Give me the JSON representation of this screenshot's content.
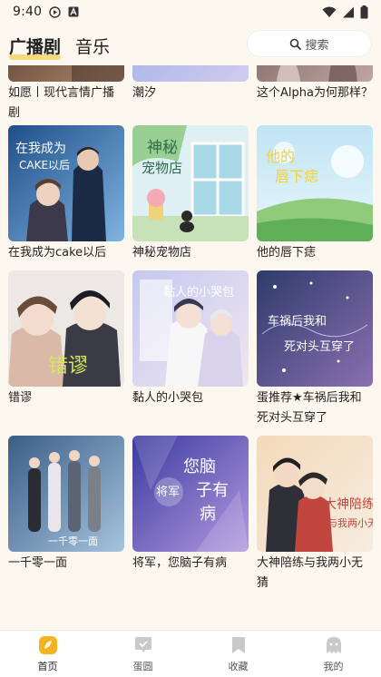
{
  "status_bar": {
    "time": "9:40",
    "icons": [
      "play-circle-icon",
      "a-box-icon",
      "wifi-icon",
      "signal-icon",
      "battery-icon"
    ]
  },
  "header": {
    "tabs": [
      {
        "label": "广播剧",
        "active": true
      },
      {
        "label": "音乐",
        "active": false
      }
    ],
    "search_label": "搜索"
  },
  "grid": {
    "items": [
      {
        "title": "如愿丨现代言情广播剧"
      },
      {
        "title": "潮汐"
      },
      {
        "title": "这个Alpha为何那样？"
      },
      {
        "title": "在我成为cake以后"
      },
      {
        "title": "神秘宠物店"
      },
      {
        "title": "他的唇下痣"
      },
      {
        "title": "错谬"
      },
      {
        "title": "黏人的小哭包"
      },
      {
        "title": "蛋推荐★车祸后我和死对头互穿了"
      },
      {
        "title": "一千零一面"
      },
      {
        "title": "将军，您脑子有病"
      },
      {
        "title": "大神陪练与我两小无猜"
      }
    ]
  },
  "bottom_nav": {
    "items": [
      {
        "label": "首页",
        "icon": "home-icon",
        "active": true
      },
      {
        "label": "蛋圆",
        "icon": "chat-icon",
        "active": false
      },
      {
        "label": "收藏",
        "icon": "bookmark-icon",
        "active": false
      },
      {
        "label": "我的",
        "icon": "ghost-icon",
        "active": false
      }
    ]
  },
  "colors": {
    "background": "#fdf8ef",
    "accent": "#f6d36a",
    "active_icon": "#f2b51f",
    "inactive_icon": "#c9c9c9"
  }
}
